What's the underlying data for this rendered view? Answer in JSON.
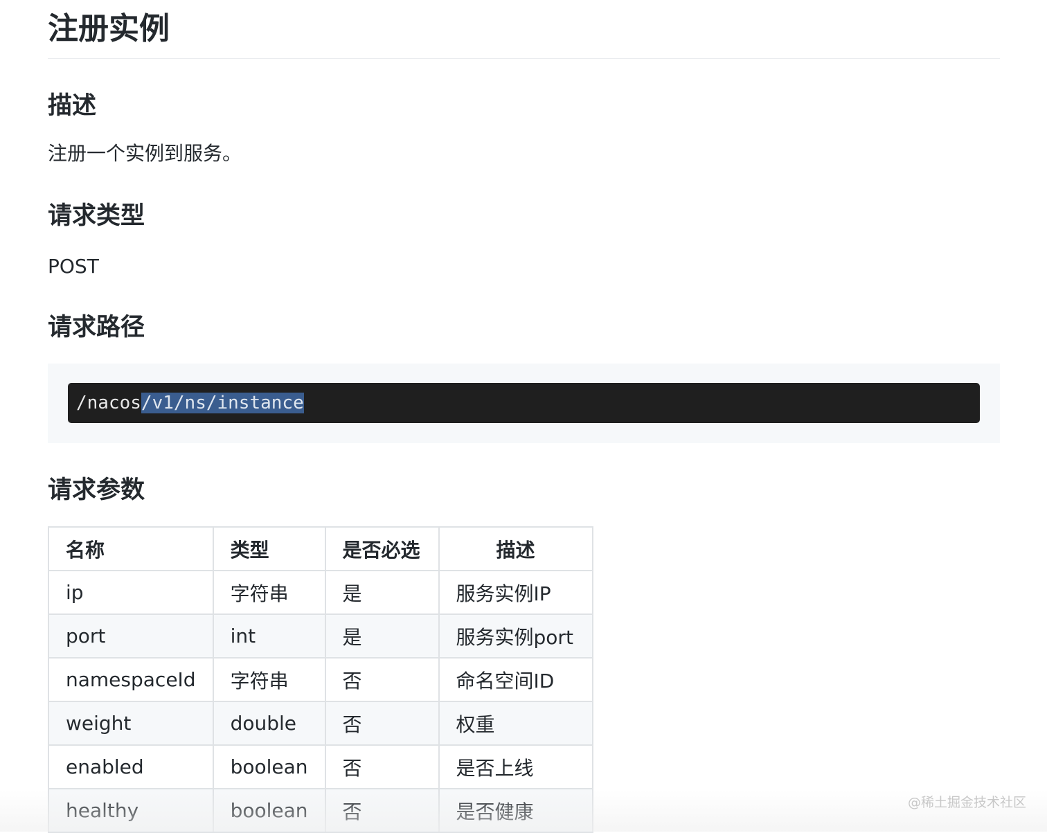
{
  "page": {
    "title": "注册实例"
  },
  "sections": {
    "description": {
      "heading": "描述",
      "text": "注册一个实例到服务。"
    },
    "method": {
      "heading": "请求类型",
      "text": "POST"
    },
    "path": {
      "heading": "请求路径",
      "code_prefix": "/nacos",
      "code_selected": "/v1/ns/instance"
    },
    "params": {
      "heading": "请求参数",
      "columns": [
        "名称",
        "类型",
        "是否必选",
        "描述"
      ],
      "rows": [
        [
          "ip",
          "字符串",
          "是",
          "服务实例IP"
        ],
        [
          "port",
          "int",
          "是",
          "服务实例port"
        ],
        [
          "namespaceId",
          "字符串",
          "否",
          "命名空间ID"
        ],
        [
          "weight",
          "double",
          "否",
          "权重"
        ],
        [
          "enabled",
          "boolean",
          "否",
          "是否上线"
        ],
        [
          "healthy",
          "boolean",
          "否",
          "是否健康"
        ]
      ]
    }
  },
  "watermark": "@稀土掘金技术社区"
}
